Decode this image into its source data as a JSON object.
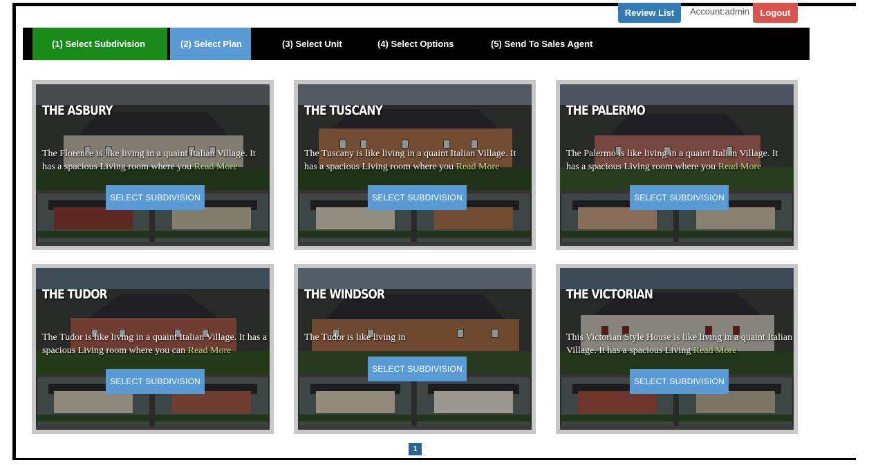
{
  "header": {
    "review_list": "Review List",
    "account": "Account:admin",
    "logout": "Logout"
  },
  "steps": [
    {
      "label": "(1) Select Subdivision",
      "state": "done"
    },
    {
      "label": "(2) Select Plan",
      "state": "active"
    },
    {
      "label": "(3) Select Unit",
      "state": "pending"
    },
    {
      "label": "(4) Select Options",
      "state": "pending"
    },
    {
      "label": "(5) Send To Sales Agent",
      "state": "pending"
    }
  ],
  "cards": [
    {
      "title": "THE ASBURY",
      "description": "The Florence is like living in a quaint Italian Village. It has a spacious Living room where you",
      "read_more": "Read More",
      "button": "SELECT SUBDIVISION"
    },
    {
      "title": "THE TUSCANY",
      "description": "The Tuscany is like living in a quaint Italian Village. It has a spacious Living room where you",
      "read_more": "Read More",
      "button": "SELECT SUBDIVISION"
    },
    {
      "title": "THE PALERMO",
      "description": "The Palermo is like living in a quaint Italian Village. It has a spacious Living room where you",
      "read_more": "Read More",
      "button": "SELECT SUBDIVISION"
    },
    {
      "title": "THE TUDOR",
      "description": "The Tudor is like living in a quaint Italian Village. It has a spacious Living room where you can",
      "read_more": "Read More",
      "button": "SELECT SUBDIVISION"
    },
    {
      "title": "THE WINDSOR",
      "description": "The Tudor is like living in",
      "read_more": "",
      "button": "SELECT SUBDIVISION"
    },
    {
      "title": "THE VICTORIAN",
      "description": "This Victorian Style House is like living in a quaint Italian Village. It has a spacious Living",
      "read_more": "Read More",
      "button": "SELECT SUBDIVISION"
    }
  ],
  "pagination": {
    "current": "1"
  },
  "colors": {
    "step_done": "#1a8a1a",
    "step_active": "#5b9bd5",
    "review_button": "#337ab7",
    "logout_button": "#d9534f",
    "read_more": "#b6e07b"
  }
}
